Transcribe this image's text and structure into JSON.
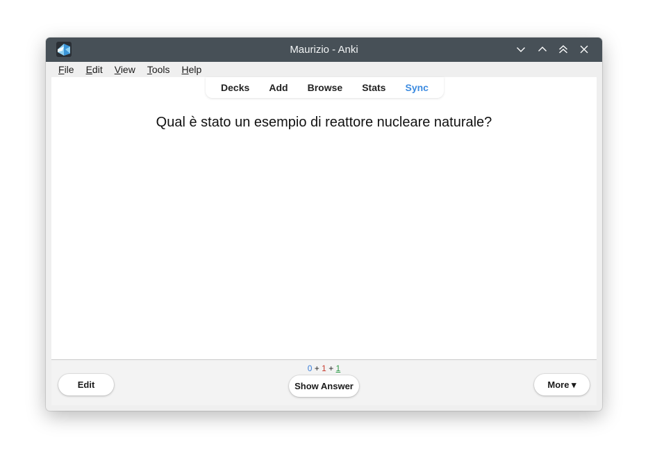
{
  "window": {
    "title": "Maurizio - Anki"
  },
  "menubar": {
    "items": [
      "File",
      "Edit",
      "View",
      "Tools",
      "Help"
    ]
  },
  "toolbar": {
    "items": [
      "Decks",
      "Add",
      "Browse",
      "Stats",
      "Sync"
    ],
    "sync_color": "#3c8be0"
  },
  "card": {
    "question": "Qual è stato un esempio di reattore nucleare naturale?"
  },
  "bottombar": {
    "counts": {
      "new": "0",
      "learning": "1",
      "review": "1",
      "sep": "+"
    },
    "edit_label": "Edit",
    "show_answer_label": "Show Answer",
    "more_label": "More ▾"
  },
  "colors": {
    "titlebar": "#475057",
    "new": "#3a7ed8",
    "learning": "#c5392b",
    "review": "#2c9a46"
  },
  "icons": {
    "app": "anki-icon",
    "controls": [
      "minimize-icon",
      "maximize-icon",
      "keep-above-icon",
      "close-icon"
    ]
  }
}
